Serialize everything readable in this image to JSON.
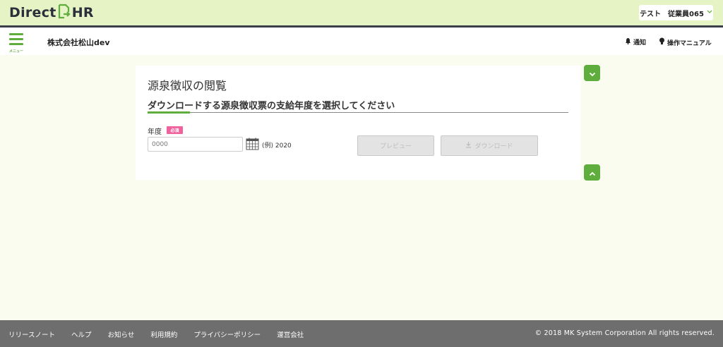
{
  "header": {
    "logo_text_left": "Direct",
    "logo_text_right": "HR",
    "user_label": "テスト　従業員065",
    "menu_label": "メニュー",
    "company": "株式会社松山dev",
    "notice_label": "通知",
    "manual_label": "操作マニュアル",
    "brand_color": "#5fae3d"
  },
  "main": {
    "page_title": "源泉徴収の閲覧",
    "section_title": "ダウンロードする源泉徴収票の支給年度を選択してください",
    "year_label": "年度",
    "required_badge": "必須",
    "year_placeholder": "0000",
    "example": "(例) 2020",
    "preview_button": "プレビュー",
    "download_button": "ダウンロード"
  },
  "footer": {
    "links": [
      "リリースノート",
      "ヘルプ",
      "お知らせ",
      "利用規約",
      "プライバシーポリシー",
      "運営会社"
    ],
    "copyright": "© 2018 MK System Corporation All rights reserved."
  }
}
